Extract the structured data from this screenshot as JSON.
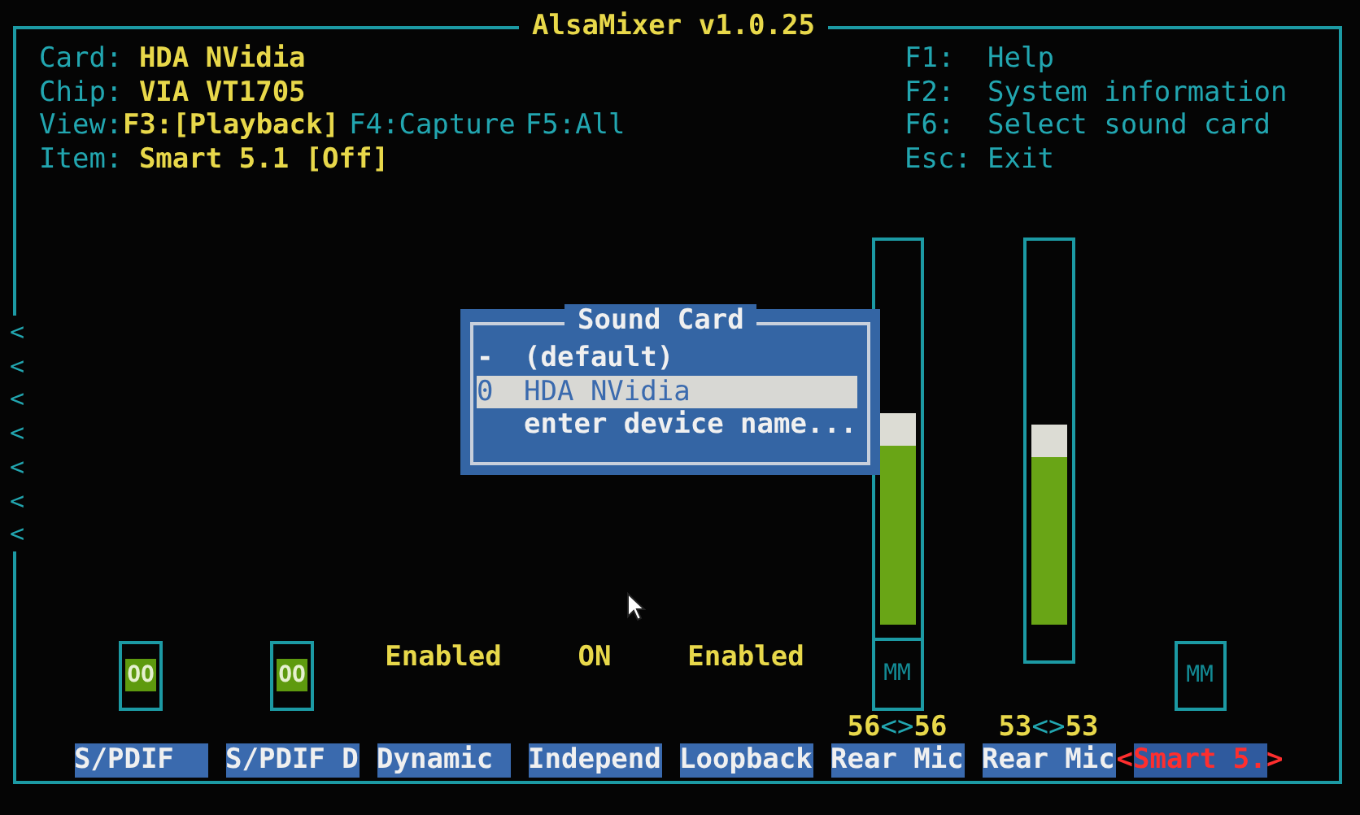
{
  "window": {
    "title": "AlsaMixer v1.0.25"
  },
  "info": [
    {
      "label": "Card:",
      "value": "HDA NVidia"
    },
    {
      "label": "Chip:",
      "value": "VIA VT1705"
    },
    {
      "label": "Item:",
      "value": "Smart 5.1 [Off]"
    }
  ],
  "view": {
    "label": "View:",
    "modes": [
      {
        "key": "F3:",
        "name": "[Playback]",
        "selected": true
      },
      {
        "key": "F4:",
        "name": "Capture",
        "selected": false
      },
      {
        "key": "F5:",
        "name": "All",
        "selected": false
      }
    ]
  },
  "help": [
    {
      "key": "F1:",
      "text": "Help"
    },
    {
      "key": "F2:",
      "text": "System information"
    },
    {
      "key": "F6:",
      "text": "Select sound card"
    },
    {
      "key": "Esc:",
      "text": "Exit"
    }
  ],
  "scroll_marks": [
    "<",
    "<",
    "<",
    "<",
    "<",
    "<",
    "<"
  ],
  "controls": [
    {
      "kind": "switch",
      "label": "S/PDIF",
      "state": "OO",
      "selected": false
    },
    {
      "kind": "switch",
      "label": "S/PDIF D",
      "state": "OO",
      "selected": false
    },
    {
      "kind": "enum",
      "label": "Dynamic",
      "state": "Enabled",
      "selected": false
    },
    {
      "kind": "enum",
      "label": "Independ",
      "state": "ON",
      "selected": false
    },
    {
      "kind": "enum",
      "label": "Loopback",
      "state": "Enabled",
      "selected": false
    },
    {
      "kind": "volume",
      "label": "Rear Mic",
      "level": 0.56,
      "mute": "MM",
      "values": [
        "56",
        "56"
      ],
      "selected": false
    },
    {
      "kind": "volume",
      "label": "Rear Mic",
      "level": 0.53,
      "values": [
        "53",
        "53"
      ],
      "selected": false
    },
    {
      "kind": "mute",
      "label": "Smart 5.",
      "mute": "MM",
      "selected": true
    }
  ],
  "value_separator": "<>",
  "selection_marks": [
    "<",
    ">"
  ],
  "dialog": {
    "title": "Sound Card",
    "items": [
      {
        "index": "-",
        "name": "(default)",
        "selected": false
      },
      {
        "index": "0",
        "name": "HDA NVidia",
        "selected": true
      },
      {
        "name": "enter device name...",
        "selected": false
      }
    ]
  }
}
